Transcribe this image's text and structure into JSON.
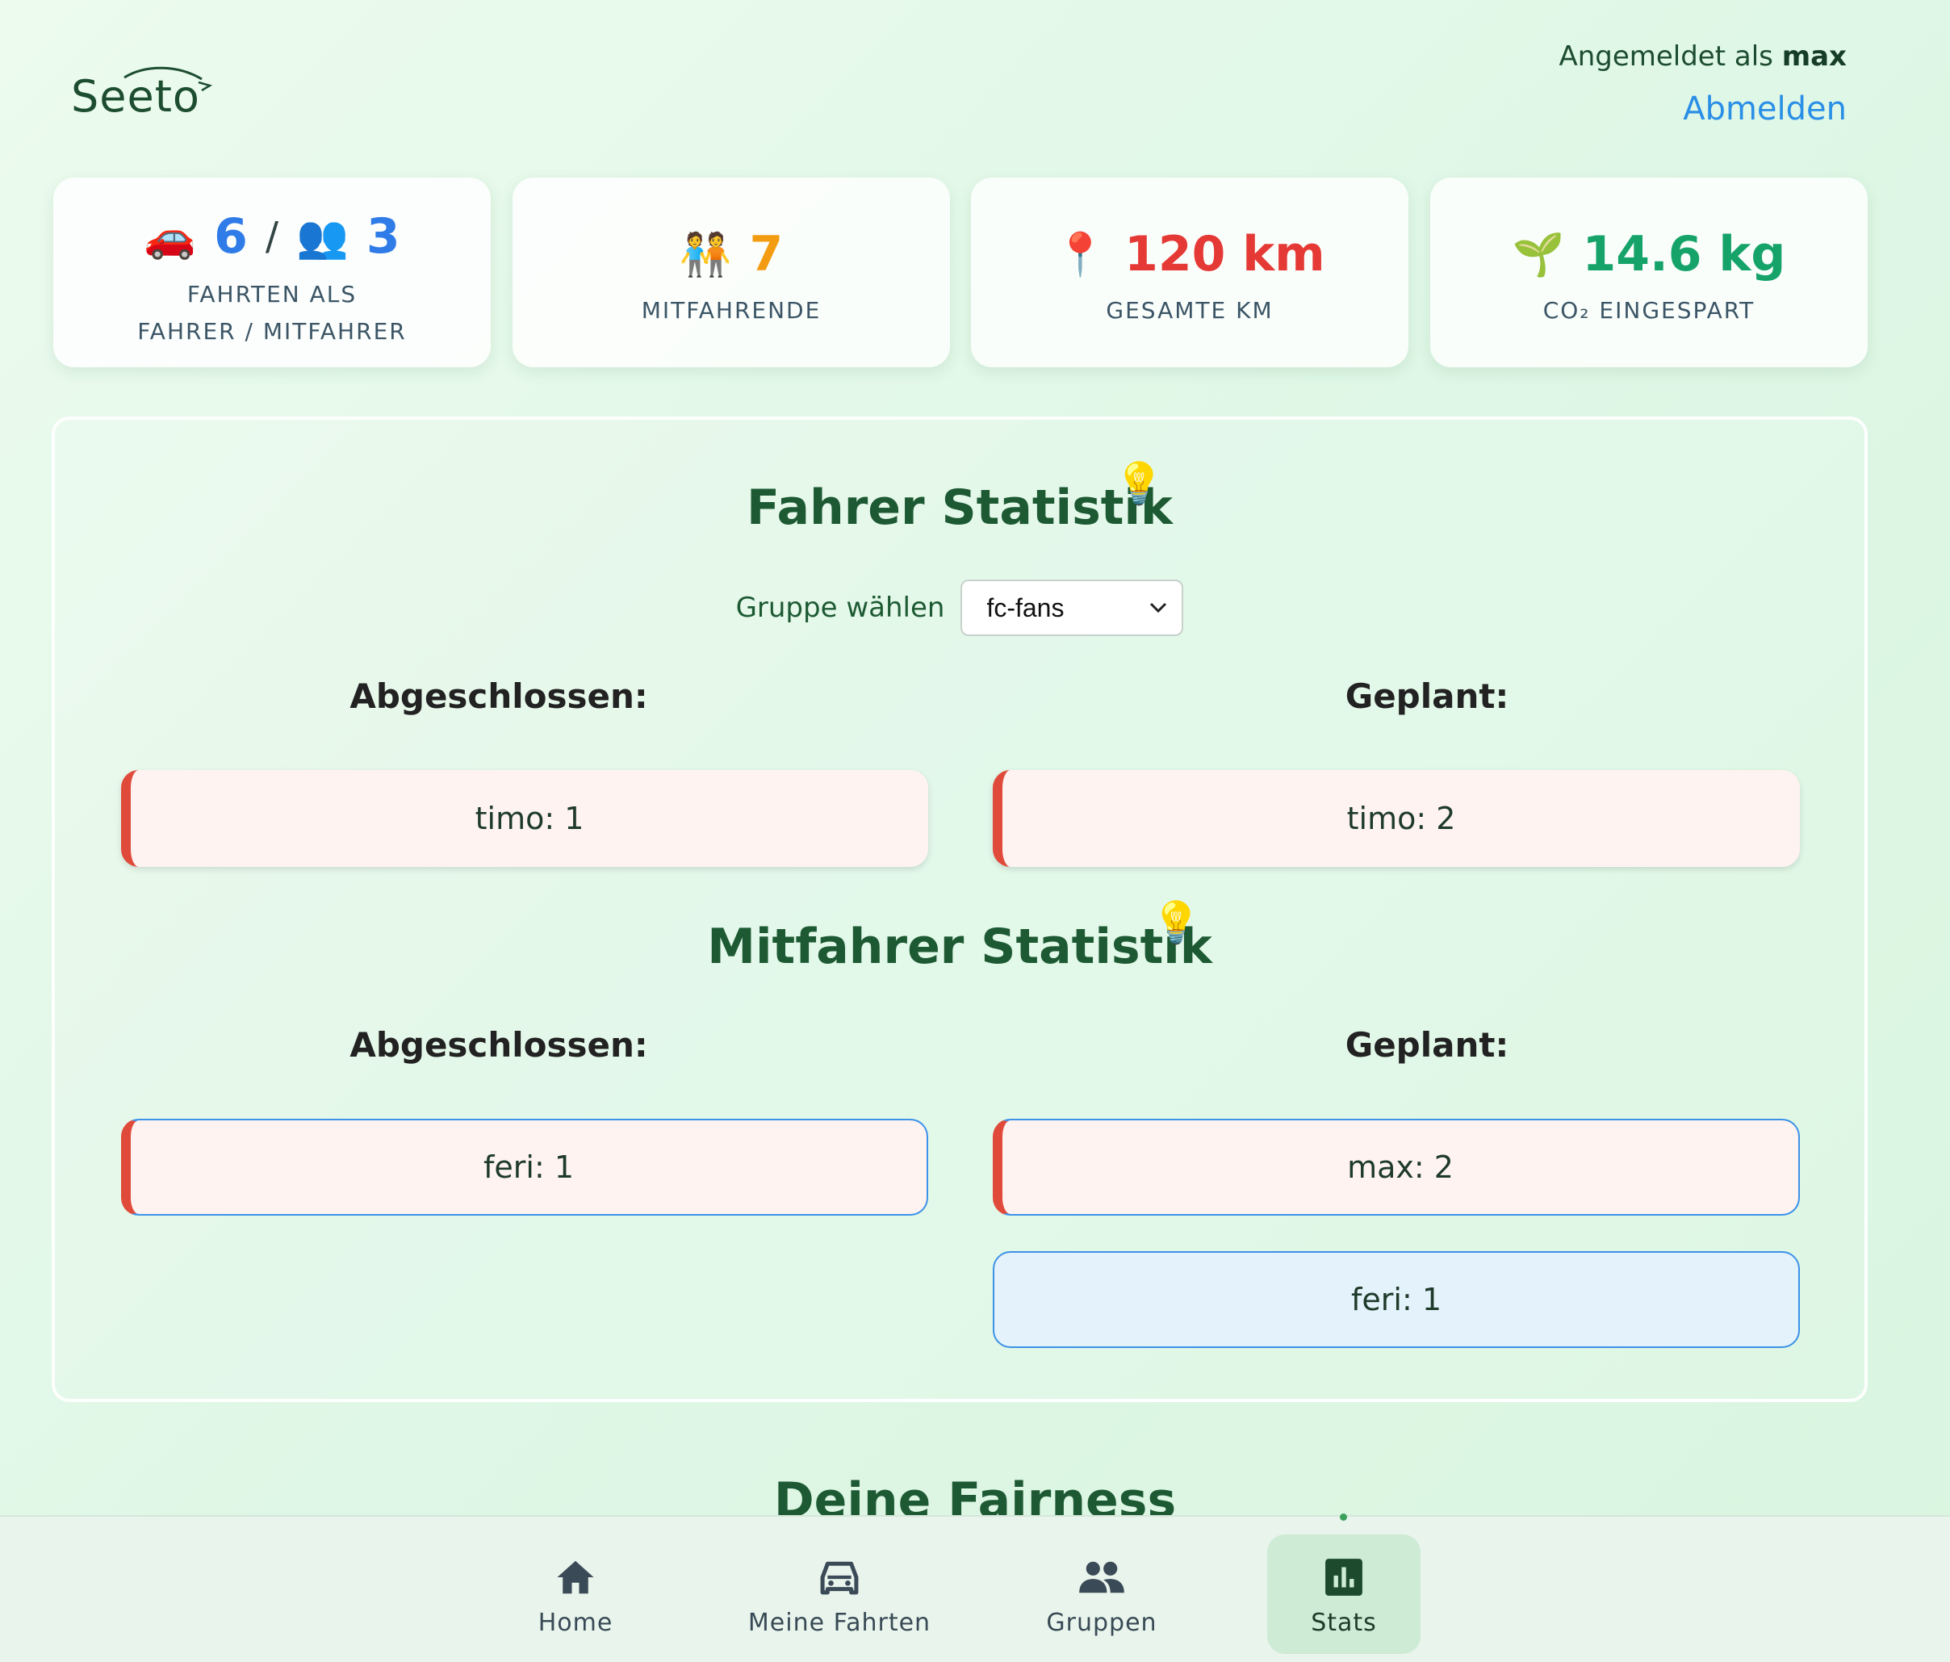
{
  "header": {
    "logo_text": "Seeto",
    "logged_in_prefix": "Angemeldet als",
    "username": "max",
    "logout_label": "Abmelden"
  },
  "stats": {
    "driver_trips": "6",
    "separator": "/",
    "passenger_trips": "3",
    "trips_label_line1": "FAHRTEN ALS",
    "trips_label_line2": "FAHRER / MITFAHRER",
    "passengers_value": "7",
    "passengers_label": "MITFAHRENDE",
    "total_km_value": "120 km",
    "total_km_label": "GESAMTE KM",
    "co2_value": "14.6 kg",
    "co2_label": "CO₂ EINGESPART"
  },
  "driver_stats": {
    "title": "Fahrer Statistik",
    "group_label": "Gruppe wählen",
    "group_selected": "fc-fans",
    "completed_heading": "Abgeschlossen:",
    "planned_heading": "Geplant:",
    "completed": [
      "timo: 1"
    ],
    "planned": [
      "timo: 2"
    ]
  },
  "passenger_stats": {
    "title": "Mitfahrer Statistik",
    "completed_heading": "Abgeschlossen:",
    "planned_heading": "Geplant:",
    "completed": [
      "feri: 1"
    ],
    "planned": [
      "max: 2",
      "feri: 1"
    ]
  },
  "fairness": {
    "title": "Deine Fairness"
  },
  "nav": {
    "items": [
      {
        "label": "Home",
        "icon": "home-icon"
      },
      {
        "label": "Meine Fahrten",
        "icon": "car-icon"
      },
      {
        "label": "Gruppen",
        "icon": "group-icon"
      },
      {
        "label": "Stats",
        "icon": "chart-icon",
        "active": true
      }
    ]
  },
  "colors": {
    "accent_green": "#1d5a33",
    "link_blue": "#2a8fe6",
    "stat_blue": "#2f7be8",
    "stat_orange": "#f39c12",
    "stat_red": "#e53935",
    "stat_green": "#16a36a"
  }
}
